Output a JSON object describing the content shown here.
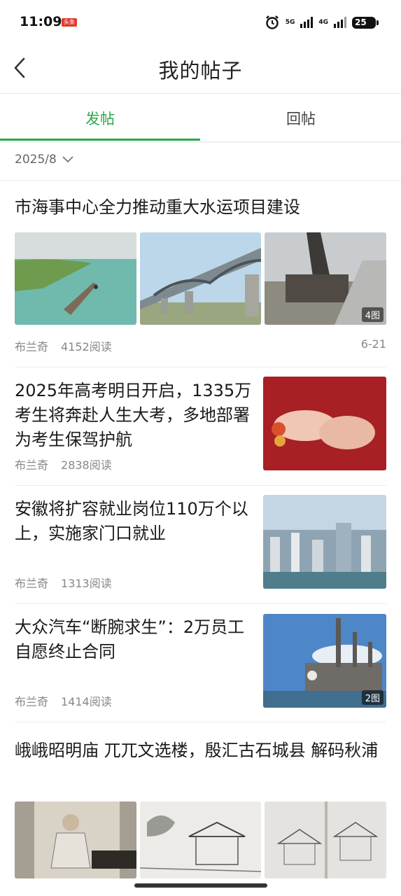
{
  "status_bar": {
    "time": "11:09",
    "app_badge": "头条",
    "network_1": "5G",
    "network_2": "4G",
    "battery": "25"
  },
  "header": {
    "title": "我的帖子"
  },
  "tabs": [
    {
      "label": "发帖",
      "active": true
    },
    {
      "label": "回帖",
      "active": false
    }
  ],
  "filter": {
    "month": "2025/8"
  },
  "posts": [
    {
      "title": "市海事中心全力推动重大水运项目建设",
      "author": "布兰奇",
      "reads": "4152阅读",
      "date": "6-21",
      "image_count": "4图"
    },
    {
      "title": "2025年高考明日开启，1335万考生将奔赴人生大考，多地部署为考生保驾护航",
      "author": "布兰奇",
      "reads": "2838阅读"
    },
    {
      "title": "安徽将扩容就业岗位110万个以上，实施家门口就业",
      "author": "布兰奇",
      "reads": "1313阅读"
    },
    {
      "title": "大众汽车“断腕求生”：2万员工自愿终止合同",
      "author": "布兰奇",
      "reads": "1414阅读",
      "image_count": "2图"
    },
    {
      "title": "峨峨昭明庙 兀兀文选楼，殷汇古石城县 解码秋浦"
    }
  ],
  "colors": {
    "accent": "#2aa84a"
  }
}
